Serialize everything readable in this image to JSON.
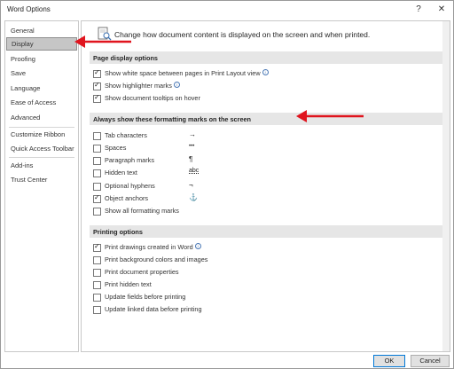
{
  "window": {
    "title": "Word Options",
    "help": "?",
    "close": "✕"
  },
  "nav": {
    "items": [
      {
        "label": "General"
      },
      {
        "label": "Display"
      },
      {
        "label": "Proofing"
      },
      {
        "label": "Save"
      },
      {
        "label": "Language"
      },
      {
        "label": "Ease of Access"
      },
      {
        "label": "Advanced"
      },
      {
        "label": "Customize Ribbon"
      },
      {
        "label": "Quick Access Toolbar"
      },
      {
        "label": "Add-ins"
      },
      {
        "label": "Trust Center"
      }
    ],
    "selected": "Display"
  },
  "header": {
    "text": "Change how document content is displayed on the screen and when printed."
  },
  "sections": {
    "page_display": {
      "title": "Page display options",
      "options": [
        {
          "label": "Show white space between pages in Print Layout view",
          "checked": true
        },
        {
          "label": "Show highlighter marks",
          "checked": true
        },
        {
          "label": "Show document tooltips on hover",
          "checked": true
        }
      ]
    },
    "formatting_marks": {
      "title": "Always show these formatting marks on the screen",
      "options": [
        {
          "label": "Tab characters",
          "glyph": "→",
          "checked": false
        },
        {
          "label": "Spaces",
          "glyph": "•••",
          "checked": false
        },
        {
          "label": "Paragraph marks",
          "glyph": "¶",
          "checked": false
        },
        {
          "label": "Hidden text",
          "glyph": "abc",
          "checked": false
        },
        {
          "label": "Optional hyphens",
          "glyph": "¬",
          "checked": false
        },
        {
          "label": "Object anchors",
          "glyph": "⚓",
          "checked": true
        },
        {
          "label": "Show all formatting marks",
          "checked": false
        }
      ]
    },
    "printing": {
      "title": "Printing options",
      "options": [
        {
          "label": "Print drawings created in Word",
          "checked": true
        },
        {
          "label": "Print background colors and images",
          "checked": false
        },
        {
          "label": "Print document properties",
          "checked": false
        },
        {
          "label": "Print hidden text",
          "checked": false
        },
        {
          "label": "Update fields before printing",
          "checked": false
        },
        {
          "label": "Update linked data before printing",
          "checked": false
        }
      ]
    }
  },
  "footer": {
    "ok": "OK",
    "cancel": "Cancel"
  },
  "annotations": {
    "arrow_color": "#e0141e"
  },
  "colors": {
    "section_bar": "#e6e6e6",
    "nav_selected": "#c6c6c6"
  }
}
